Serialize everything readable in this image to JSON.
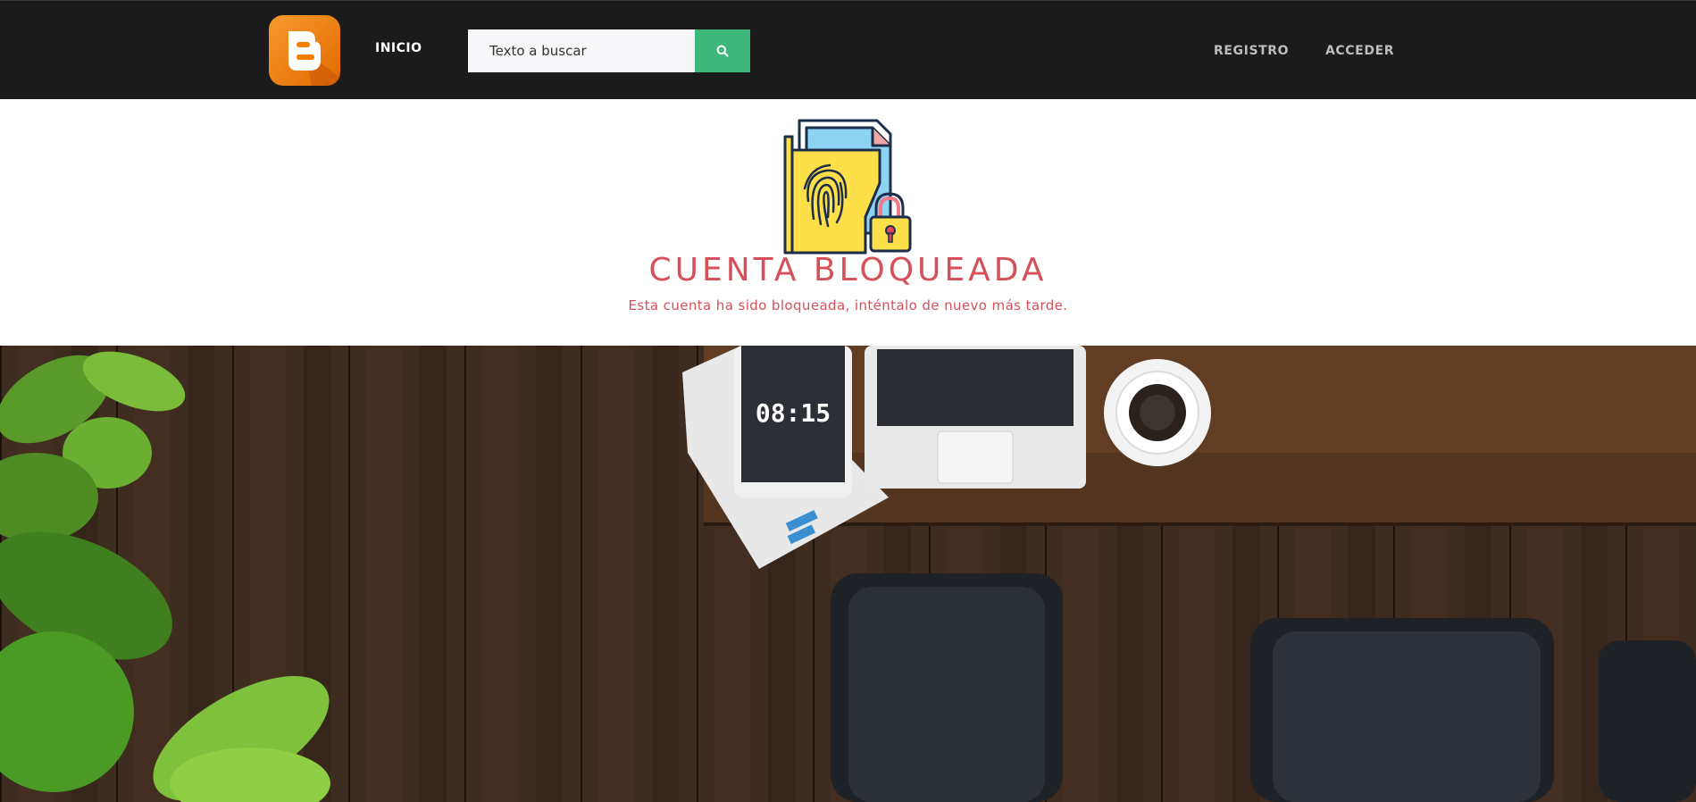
{
  "nav": {
    "home_label": "INICIO",
    "search": {
      "placeholder": "Texto a buscar",
      "value": ""
    },
    "register_label": "REGISTRO",
    "login_label": "ACCEDER",
    "logo_icon": "blogger-logo-icon",
    "search_icon": "search-icon"
  },
  "locked": {
    "title": "CUENTA BLOQUEADA",
    "message": "Esta cuenta ha sido bloqueada, inténtalo de nuevo más tarde.",
    "illustration_icon": "locked-folder-fingerprint-icon"
  },
  "hero": {
    "tablet_time": "08:15"
  },
  "colors": {
    "navbar": "#1b1b1b",
    "accent_green": "#3db87a",
    "alert_red": "#d6505a",
    "logo_orange": "#f57d00"
  }
}
